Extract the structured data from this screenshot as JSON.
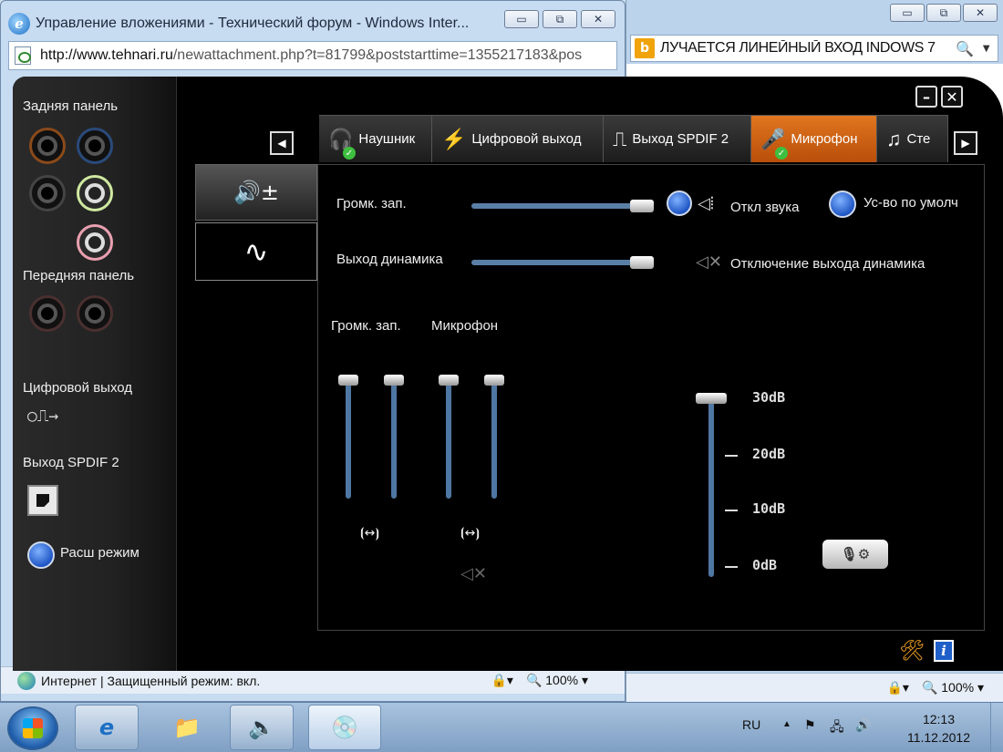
{
  "background_window": {
    "caption_buttons": [
      "▭",
      "⧉",
      "✕"
    ],
    "search_text": "ЛУЧАЕТСЯ ЛИНЕЙНЫЙ ВХОД INDOWS 7",
    "zoom": "100%"
  },
  "foreground_window": {
    "title": "Управление вложениями - Технический форум - Windows Inter...",
    "caption_buttons": [
      "▭",
      "⧉",
      "✕"
    ],
    "address_domain": "http://www.tehnari.ru",
    "address_rest": "/newattachment.php?t=81799&poststarttime=1355217183&pos",
    "status_text": "Интернет | Защищенный режим: вкл.",
    "zoom": "100%"
  },
  "realtek": {
    "left": {
      "rear_panel_label": "Задняя панель",
      "front_panel_label": "Передняя панель",
      "digital_out_label": "Цифровой выход",
      "spdif2_label": "Выход SPDIF 2",
      "advanced_mode_label": "Расш режим"
    },
    "tabs": [
      {
        "label": "Наушник",
        "icon": "headphones-icon"
      },
      {
        "label": "Цифровой выход",
        "icon": "digital-plug-icon"
      },
      {
        "label": "Выход SPDIF 2",
        "icon": "spdif-wave-icon"
      },
      {
        "label": "Микрофон",
        "icon": "microphone-icon"
      },
      {
        "label": "Сте",
        "icon": "music-note-icon"
      }
    ],
    "active_tab": "Микрофон",
    "panel": {
      "rec_volume_label": "Громк. зап.",
      "speaker_out_label": "Выход динамика",
      "mute_label": "Откл звука",
      "default_device_label": "Ус-во по умолч",
      "speaker_mute_label": "Отключение выхода динамика",
      "col_rec_volume": "Громк. зап.",
      "col_microphone": "Микрофон",
      "boost_levels": [
        "30dB",
        "20dB",
        "10dB",
        "0dB"
      ],
      "boost_value": "30dB",
      "rec_volume_level": 1.0,
      "speaker_out_level": 1.0
    },
    "window_controls": [
      "–",
      "✕"
    ]
  },
  "taskbar": {
    "lang": "RU",
    "time": "12:13",
    "date": "11.12.2012"
  }
}
